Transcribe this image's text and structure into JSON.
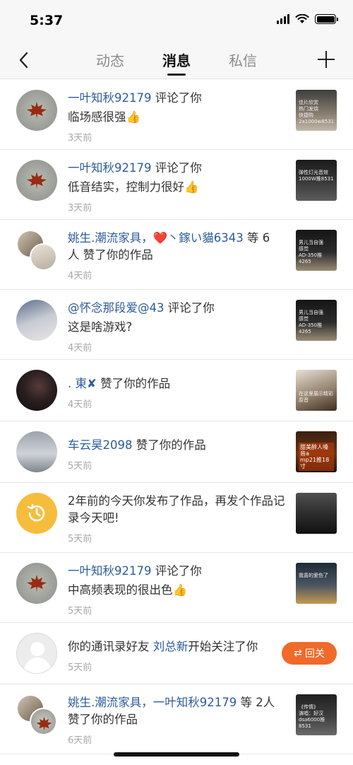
{
  "status_bar": {
    "time": "5:37"
  },
  "nav": {
    "tabs": [
      {
        "label": "动态",
        "active": false
      },
      {
        "label": "消息",
        "active": true
      },
      {
        "label": "私信",
        "active": false
      }
    ]
  },
  "notifications": [
    {
      "user": "一叶知秋92179",
      "action": " 评论了你",
      "content": "临场感很强",
      "emoji": "👍",
      "time": "3天前",
      "thumb_caption": "佳片欣赏 \n热门发烧\n快捷购\n2a1000w8531"
    },
    {
      "user": "一叶知秋92179",
      "action": " 评论了你",
      "content": "低音结实，控制力很好",
      "emoji": "👍",
      "time": "3天前",
      "thumb_caption": "弹性灯光音效\n1000W推8531"
    },
    {
      "user_prefix": "姚生.潮流家具，",
      "heart": "❤️",
      "user": "丶鎵い貓6343",
      "action_mid": " 等 6",
      "action": "人 赞了你的作品",
      "time": "4天前",
      "thumb_caption": "男儿当自强\n感觉\nAD-350推4265"
    },
    {
      "user": "@怀念那段爱@43",
      "action": " 评论了你",
      "content": "这是啥游戏?",
      "time": "4天前",
      "thumb_caption": "男儿当自强\n感觉\nAD-350推4265"
    },
    {
      "user": ". 東",
      "mark": "✘",
      "action": " 赞了你的作品",
      "time": "4天前",
      "thumb_caption": "在这里展示精彩原音"
    },
    {
      "user": "车云昊2098",
      "action": " 赞了你的作品",
      "time": "5天前",
      "thumb_caption": "甜美醉人嗓音a\nmp21推18寸"
    },
    {
      "text": "2年前的今天你发布了作品，再发个作品记录今天吧!",
      "time": "5天前",
      "thumb_caption": ""
    },
    {
      "user": "一叶知秋92179",
      "action": " 评论了你",
      "content": "中高频表现的很出色",
      "emoji": "👍",
      "time": "5天前",
      "thumb_caption": "我喜的爱伤了"
    },
    {
      "prefix": "你的通讯录好友 ",
      "user": "刘总新",
      "action": "开始关注了你",
      "time": "5天前",
      "button_label": "回关",
      "button_icon": "⇄"
    },
    {
      "user_prefix": "姚生.潮流家具，",
      "user": "一叶知秋92179",
      "action_mid": " 等 2人",
      "action": "赞了你的作品",
      "time": "6天前",
      "thumb_caption": "《传情》\n演唱：好汉\ndsa6000推8531"
    }
  ]
}
